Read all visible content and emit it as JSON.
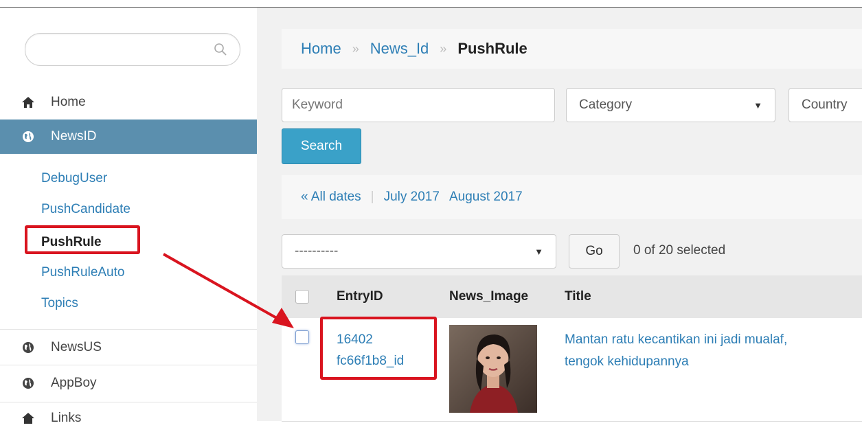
{
  "sidebar": {
    "search": {
      "value": "",
      "placeholder": ""
    },
    "nav": {
      "home": "Home",
      "newsid": "NewsID",
      "newsus": "NewsUS",
      "appboy": "AppBoy",
      "links": "Links"
    },
    "subitems": {
      "debug_user": "DebugUser",
      "push_candidate": "PushCandidate",
      "push_rule": "PushRule",
      "push_rule_auto": "PushRuleAuto",
      "topics": "Topics"
    }
  },
  "breadcrumb": {
    "home": "Home",
    "sep1": "»",
    "news_id": "News_Id",
    "sep2": "»",
    "current": "PushRule"
  },
  "filters": {
    "keyword_placeholder": "Keyword",
    "category": "Category",
    "country": "Country",
    "search_button": "Search"
  },
  "dates": {
    "all": "« All dates",
    "sep": "|",
    "july": "July 2017",
    "august": "August 2017"
  },
  "actions": {
    "select_value": "----------",
    "go_button": "Go",
    "selected_count": "0 of 20 selected"
  },
  "table": {
    "headers": {
      "entry_id": "EntryID",
      "news_image": "News_Image",
      "title": "Title"
    },
    "rows": [
      {
        "entry_id_line1": "16402",
        "entry_id_line2": "fc66f1b8_id",
        "title_line1": "Mantan ratu kecantikan ini jadi mualaf,",
        "title_line2": "tengok kehidupannya"
      }
    ]
  },
  "colors": {
    "accent": "#5b8fae",
    "link": "#2d7eb5",
    "button": "#3aa1c8",
    "highlight": "#d9141f"
  }
}
